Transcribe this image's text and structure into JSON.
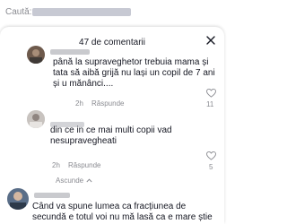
{
  "search": {
    "label": "Caută:"
  },
  "comments_sheet": {
    "title": "47 de comentarii"
  },
  "replies": [
    {
      "lines": [
        "până la supraveghetor trebuia mama și",
        "tata să aibă grijă nu lași un copil de 7 ani",
        "și u mănânci...."
      ],
      "time": "2h",
      "reply_label": "Răspunde",
      "like_count": "11"
    },
    {
      "lines": [
        "din ce in ce mai multi copii vad",
        "nesupravegheati"
      ],
      "time": "2h",
      "reply_label": "Răspunde",
      "like_count": "5"
    }
  ],
  "collapse_label": "Ascunde",
  "bottom_comment": {
    "lines": [
      "Când va spune lumea ca fracțiunea de",
      "secundă e totul voi nu mă lasă ca e mare știe"
    ]
  },
  "colors": {
    "accent": "#fe2c55",
    "muted": "#8a8b91",
    "text": "#161823"
  }
}
